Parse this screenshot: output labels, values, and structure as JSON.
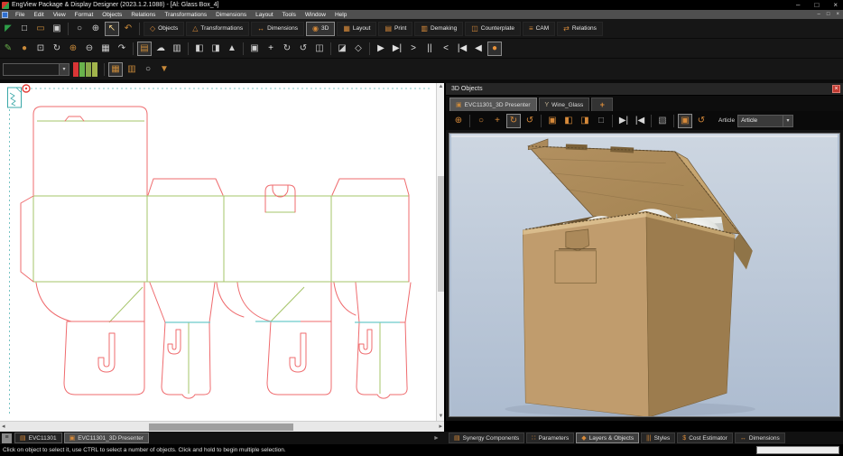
{
  "window": {
    "title": "EngView Package & Display Designer (2023.1.2.1088) - [Al: Glass Box_4]",
    "controls": {
      "minimize": "–",
      "maximize": "□",
      "close": "×"
    },
    "mdi_controls": {
      "minimize": "–",
      "restore": "□",
      "close": "×"
    }
  },
  "menu_bar": {
    "items": [
      {
        "name": "menu-file",
        "label": "File"
      },
      {
        "name": "menu-edit",
        "label": "Edit"
      },
      {
        "name": "menu-view",
        "label": "View"
      },
      {
        "name": "menu-format",
        "label": "Format"
      },
      {
        "name": "menu-objects",
        "label": "Objects"
      },
      {
        "name": "menu-relations",
        "label": "Relations"
      },
      {
        "name": "menu-transformations",
        "label": "Transformations"
      },
      {
        "name": "menu-dimensions",
        "label": "Dimensions"
      },
      {
        "name": "menu-layout",
        "label": "Layout"
      },
      {
        "name": "menu-tools",
        "label": "Tools"
      },
      {
        "name": "menu-window",
        "label": "Window"
      },
      {
        "name": "menu-help",
        "label": "Help"
      }
    ]
  },
  "toolbar_row1": {
    "icons": [
      {
        "name": "engview-app-icon",
        "glyph": "◤",
        "color": "#2e9e49"
      },
      {
        "name": "new-document-icon",
        "glyph": "□",
        "color": "#e8e8e8"
      },
      {
        "name": "open-folder-icon",
        "glyph": "▭",
        "color": "#c98a3a"
      },
      {
        "name": "save-icon",
        "glyph": "▣",
        "color": "#cfcfcf"
      },
      {
        "sep": true
      },
      {
        "name": "zoom-icon",
        "glyph": "○",
        "color": "#cfcfcf"
      },
      {
        "name": "zoom-in-icon",
        "glyph": "⊕",
        "color": "#cfcfcf"
      },
      {
        "name": "select-arrow-icon",
        "glyph": "↖",
        "color": "#f2d28a",
        "active": true
      },
      {
        "name": "undo-icon",
        "glyph": "↶",
        "color": "#c98a3a"
      }
    ],
    "buttons": [
      {
        "name": "toolbar-button-objects",
        "label": "Objects",
        "glyph": "◇"
      },
      {
        "name": "toolbar-button-transformations",
        "label": "Transformations",
        "glyph": "△"
      },
      {
        "name": "toolbar-button-dimensions",
        "label": "Dimensions",
        "glyph": "↔"
      },
      {
        "name": "toolbar-button-3d",
        "label": "3D",
        "glyph": "◉",
        "active": true
      },
      {
        "name": "toolbar-button-layout",
        "label": "Layout",
        "glyph": "▦"
      },
      {
        "name": "toolbar-button-print",
        "label": "Print",
        "glyph": "▤"
      },
      {
        "name": "toolbar-button-demaking",
        "label": "Demaking",
        "glyph": "▥"
      },
      {
        "name": "toolbar-button-counterplate",
        "label": "Counterplate",
        "glyph": "◫"
      },
      {
        "name": "toolbar-button-cam",
        "label": "CAM",
        "glyph": "≡"
      },
      {
        "name": "toolbar-button-relations",
        "label": "Relations",
        "glyph": "⇄"
      }
    ]
  },
  "toolbar_row2": {
    "icons": [
      {
        "name": "edit-drawing-icon",
        "glyph": "✎",
        "color": "#6ab04c"
      },
      {
        "name": "shape-fill-icon",
        "glyph": "●",
        "color": "#c98a3a"
      },
      {
        "name": "preview-document-icon",
        "glyph": "⊡",
        "color": "#cfcfcf"
      },
      {
        "name": "refresh-icon",
        "glyph": "↻",
        "color": "#cfcfcf"
      },
      {
        "name": "zoom-area-icon",
        "glyph": "⊕",
        "color": "#c98a3a"
      },
      {
        "name": "zoom-out-icon",
        "glyph": "⊖",
        "color": "#cfcfcf"
      },
      {
        "name": "spreadsheet-icon",
        "glyph": "▦",
        "color": "#cfcfcf"
      },
      {
        "name": "redo-icon",
        "glyph": "↷",
        "color": "#cfcfcf"
      },
      {
        "sep": true
      },
      {
        "name": "document-3d-icon",
        "glyph": "▤",
        "color": "#c98a3a",
        "active": true
      },
      {
        "name": "cloud-upload-icon",
        "glyph": "☁",
        "color": "#cfcfcf"
      },
      {
        "name": "report-icon",
        "glyph": "▥",
        "color": "#cfcfcf"
      },
      {
        "sep": true
      },
      {
        "name": "fold-carton-icon",
        "glyph": "◧",
        "color": "#cfcfcf"
      },
      {
        "name": "stack-icon",
        "glyph": "◨",
        "color": "#cfcfcf"
      },
      {
        "name": "render-scene-icon",
        "glyph": "▲",
        "color": "#cfcfcf"
      },
      {
        "sep": true
      },
      {
        "name": "material-box-icon",
        "glyph": "▣",
        "color": "#cfcfcf"
      },
      {
        "name": "pan-icon",
        "glyph": "+",
        "color": "#e8e8e8"
      },
      {
        "name": "orbit-icon",
        "glyph": "↻",
        "color": "#cfcfcf"
      },
      {
        "name": "turntable-icon",
        "glyph": "↺",
        "color": "#cfcfcf"
      },
      {
        "name": "duplicate-view-icon",
        "glyph": "◫",
        "color": "#cfcfcf"
      },
      {
        "sep": true
      },
      {
        "name": "snapshot-icon",
        "glyph": "◪",
        "color": "#cfcfcf"
      },
      {
        "name": "cube-icon",
        "glyph": "◇",
        "color": "#cfcfcf"
      },
      {
        "sep": true
      },
      {
        "name": "play-icon",
        "glyph": "▶",
        "color": "#e0e0e0"
      },
      {
        "name": "skip-end-icon",
        "glyph": "▶|",
        "color": "#e0e0e0"
      },
      {
        "name": "forward-icon",
        "glyph": ">",
        "color": "#e0e0e0"
      },
      {
        "name": "pause-icon",
        "glyph": "||",
        "color": "#e0e0e0"
      },
      {
        "name": "back-icon",
        "glyph": "<",
        "color": "#e0e0e0"
      },
      {
        "name": "skip-start-icon",
        "glyph": "|◀",
        "color": "#e0e0e0"
      },
      {
        "name": "step-back-icon",
        "glyph": "◀",
        "color": "#e0e0e0"
      },
      {
        "name": "render-sphere-icon",
        "glyph": "●",
        "color": "#e8923a",
        "active": true
      }
    ]
  },
  "toolbar_row3": {
    "layer_combobox": {
      "value": "",
      "name": "layer-combobox"
    },
    "swatch_colors": [
      "#d93636",
      "#69b34c",
      "#8aa84a",
      "#a2b44c"
    ],
    "icons": [
      {
        "name": "dieline-layers-icon",
        "glyph": "▦",
        "color": "#c98a3a",
        "active": true
      },
      {
        "name": "column-settings-icon",
        "glyph": "▥",
        "color": "#c98a3a"
      },
      {
        "name": "lasso-icon",
        "glyph": "○",
        "color": "#cfcfcf"
      },
      {
        "name": "filter-icon",
        "glyph": "▼",
        "color": "#c98a3a"
      }
    ]
  },
  "right_panel": {
    "title": "3D Objects",
    "close_glyph": "×",
    "tabs": [
      {
        "name": "tab-evc11301-3d-presenter",
        "label": "EVC11301_3D Presenter",
        "glyph": "▣",
        "color": "#c9893b",
        "active": true
      },
      {
        "name": "tab-wine-glass",
        "label": "Wine_Glass",
        "glyph": "Y",
        "color": "#c5b493"
      },
      {
        "name": "tab-add-new",
        "label": "+",
        "glyph": "",
        "color": "#d78a3a"
      }
    ],
    "toolbar": {
      "icons": [
        {
          "name": "zoom-in-3d-icon",
          "glyph": "⊕"
        },
        {
          "sep": true
        },
        {
          "name": "zoom-3d-icon",
          "glyph": "○"
        },
        {
          "name": "pan-3d-icon",
          "glyph": "+"
        },
        {
          "name": "orbit-3d-icon",
          "glyph": "↻",
          "active": true
        },
        {
          "name": "turntable-3d-icon",
          "glyph": "↺"
        },
        {
          "sep": true
        },
        {
          "name": "box-closed-icon",
          "glyph": "▣"
        },
        {
          "name": "box-open-icon",
          "glyph": "◧"
        },
        {
          "name": "box-lid-icon",
          "glyph": "◨"
        },
        {
          "name": "box-wireframe-icon",
          "glyph": "□",
          "color": "#9a9a9a"
        },
        {
          "sep": true
        },
        {
          "name": "fold-forward-icon",
          "glyph": "▶|",
          "color": "#d8d8d8"
        },
        {
          "name": "fold-back-icon",
          "glyph": "|◀",
          "color": "#d8d8d8"
        },
        {
          "sep": true
        },
        {
          "name": "cube-grey-icon",
          "glyph": "▧",
          "color": "#9a9a9a"
        },
        {
          "sep": true
        },
        {
          "name": "box-screen-icon",
          "glyph": "▣",
          "active": true
        },
        {
          "name": "fold-unfold-icon",
          "glyph": "↺"
        }
      ],
      "article_label": "Article",
      "article_value": "Article"
    }
  },
  "document_tabs": {
    "grip_glyph": "≡",
    "scroll_glyph": "►",
    "tabs": [
      {
        "name": "doc-tab-evc11301",
        "label": "EVC11301",
        "glyph": "▤"
      },
      {
        "name": "doc-tab-evc11301-3d-presenter",
        "label": "EVC11301_3D Presenter",
        "glyph": "▣",
        "active": true
      }
    ]
  },
  "bottom_buttons": [
    {
      "name": "synergy-components-button",
      "label": "Synergy Components",
      "glyph": "▤"
    },
    {
      "name": "parameters-button",
      "label": "Parameters",
      "glyph": "∷"
    },
    {
      "name": "layers-objects-button",
      "label": "Layers & Objects",
      "glyph": "◆",
      "active": true
    },
    {
      "name": "styles-button",
      "label": "Styles",
      "glyph": "|||"
    },
    {
      "name": "cost-estimator-button",
      "label": "Cost Estimator",
      "glyph": "$"
    },
    {
      "name": "dimensions-button",
      "label": "Dimensions",
      "glyph": "↔"
    }
  ],
  "status_bar": {
    "text": "Click on object to select it, use CTRL to select a number of objects. Click and hold to begin multiple selection."
  },
  "colors": {
    "accent_orange": "#d78a3a",
    "canvas_bg": "#ffffff",
    "dieline_red": "#ef6b6e",
    "dieline_green": "#a5c468",
    "dieline_cyan": "#6cc9c9",
    "sheet_teal": "#3aa8a8",
    "viewport_top": "#cdd6e1",
    "viewport_bottom": "#b0bfd2",
    "box_light": "#c09c6d",
    "box_dark": "#9c7c4e",
    "box_lid": "#ab895a",
    "box_lid_edge": "#c7a671",
    "box_inner": "#6b5433",
    "insert_grey": "#c9ccc9",
    "status_red": "#c23b32",
    "logo_green": "#2e9e49"
  }
}
